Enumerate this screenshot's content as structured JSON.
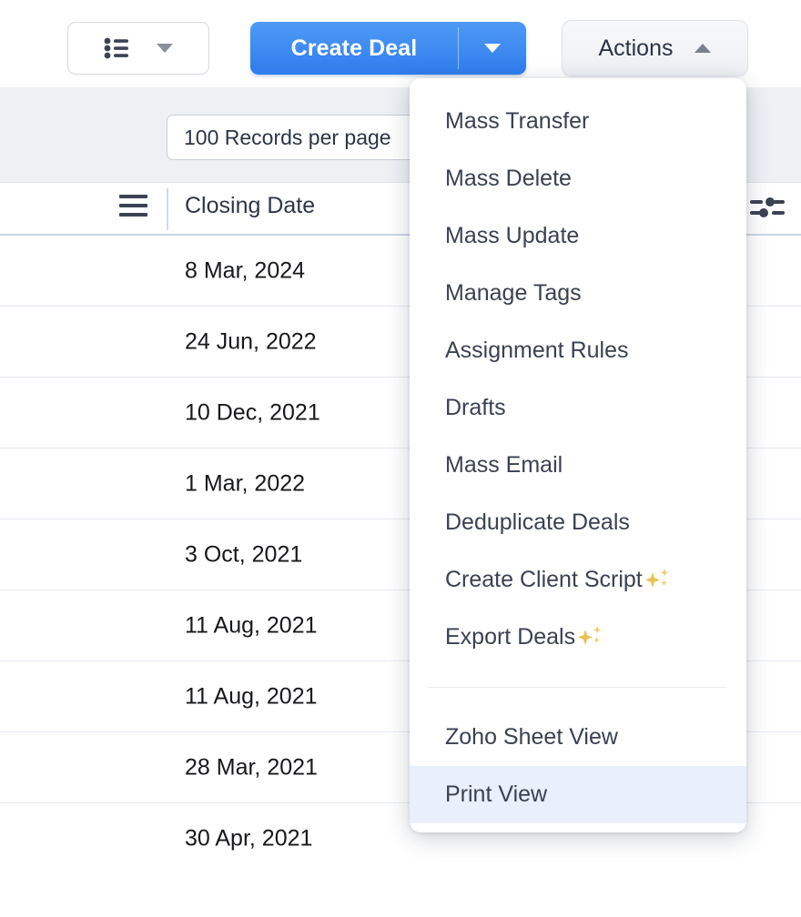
{
  "toolbar": {
    "listview_button": {
      "icon": "list-bullet-icon",
      "caret": "chevron-down-icon"
    },
    "create_deal": {
      "label": "Create Deal",
      "caret": "chevron-down-icon"
    },
    "actions": {
      "label": "Actions",
      "caret": "chevron-up-icon",
      "expanded": true
    }
  },
  "records_per_page": {
    "value": "100 Records per page",
    "placeholder": "Records per page"
  },
  "table": {
    "menu_icon": "hamburger-icon",
    "settings_icon": "sliders-icon",
    "column_header": "Closing Date",
    "rows": [
      {
        "closing_date": "8 Mar, 2024"
      },
      {
        "closing_date": "24 Jun, 2022"
      },
      {
        "closing_date": "10 Dec, 2021"
      },
      {
        "closing_date": "1 Mar, 2022"
      },
      {
        "closing_date": "3 Oct, 2021"
      },
      {
        "closing_date": "11 Aug, 2021"
      },
      {
        "closing_date": "11 Aug, 2021"
      },
      {
        "closing_date": "28 Mar, 2021"
      },
      {
        "closing_date": "30 Apr, 2021"
      }
    ]
  },
  "actions_menu": {
    "items": [
      {
        "label": "Mass Transfer",
        "sparkle": false,
        "highlighted": false
      },
      {
        "label": "Mass Delete",
        "sparkle": false,
        "highlighted": false
      },
      {
        "label": "Mass Update",
        "sparkle": false,
        "highlighted": false
      },
      {
        "label": "Manage Tags",
        "sparkle": false,
        "highlighted": false
      },
      {
        "label": "Assignment Rules",
        "sparkle": false,
        "highlighted": false
      },
      {
        "label": "Drafts",
        "sparkle": false,
        "highlighted": false
      },
      {
        "label": "Mass Email",
        "sparkle": false,
        "highlighted": false
      },
      {
        "label": "Deduplicate Deals",
        "sparkle": false,
        "highlighted": false
      },
      {
        "label": "Create Client Script",
        "sparkle": true,
        "highlighted": false
      },
      {
        "label": "Export Deals",
        "sparkle": true,
        "highlighted": false
      }
    ],
    "items_after_separator": [
      {
        "label": "Zoho Sheet View",
        "sparkle": false,
        "highlighted": false
      },
      {
        "label": "Print View",
        "sparkle": false,
        "highlighted": true
      }
    ]
  },
  "colors": {
    "primary_blue": "#2f7ded",
    "menu_highlight": "#e9effb",
    "text_dark": "#3a4151",
    "sparkle_gold": "#e8c252",
    "strip_bg": "#eef0f4",
    "row_border": "#e6eaf2"
  }
}
